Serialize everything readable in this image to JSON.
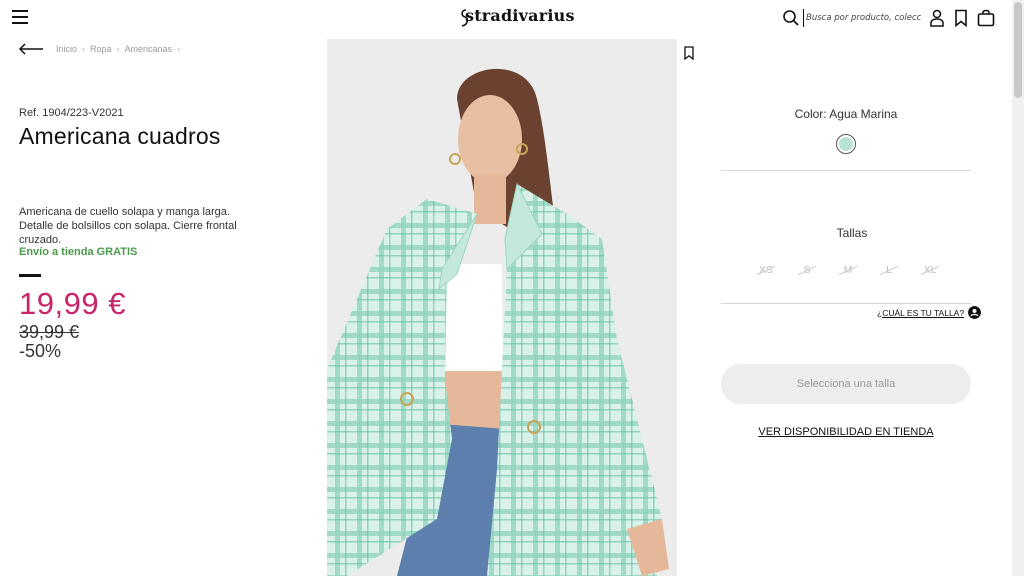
{
  "header": {
    "logo": "stradivarius",
    "search_placeholder": "Busca por producto, colección..."
  },
  "breadcrumb": [
    "Inicio",
    "Ropa",
    "Americanas"
  ],
  "product": {
    "ref": "Ref. 1904/223-V2021",
    "title": "Americana cuadros",
    "description": "Americana de cuello solapa y manga larga. Detalle de bolsillos con solapa. Cierre frontal cruzado.",
    "shipping": "Envío a tienda GRATIS",
    "price": "19,99 €",
    "old_price": "39,99 €",
    "discount": "-50%"
  },
  "options": {
    "color_label": "Color: Agua Marina",
    "swatch_color": "#b9e2d6",
    "sizes_label": "Tallas",
    "sizes": [
      "XS",
      "S",
      "M",
      "L",
      "XL"
    ],
    "size_guide": "¿CUÁL ES TU TALLA?",
    "select_button": "Selecciona una talla",
    "availability_link": "VER DISPONIBILIDAD EN TIENDA"
  },
  "colors": {
    "price": "#c8256a",
    "shipping": "#4a9a4a",
    "jacket": "#a8dccb"
  }
}
